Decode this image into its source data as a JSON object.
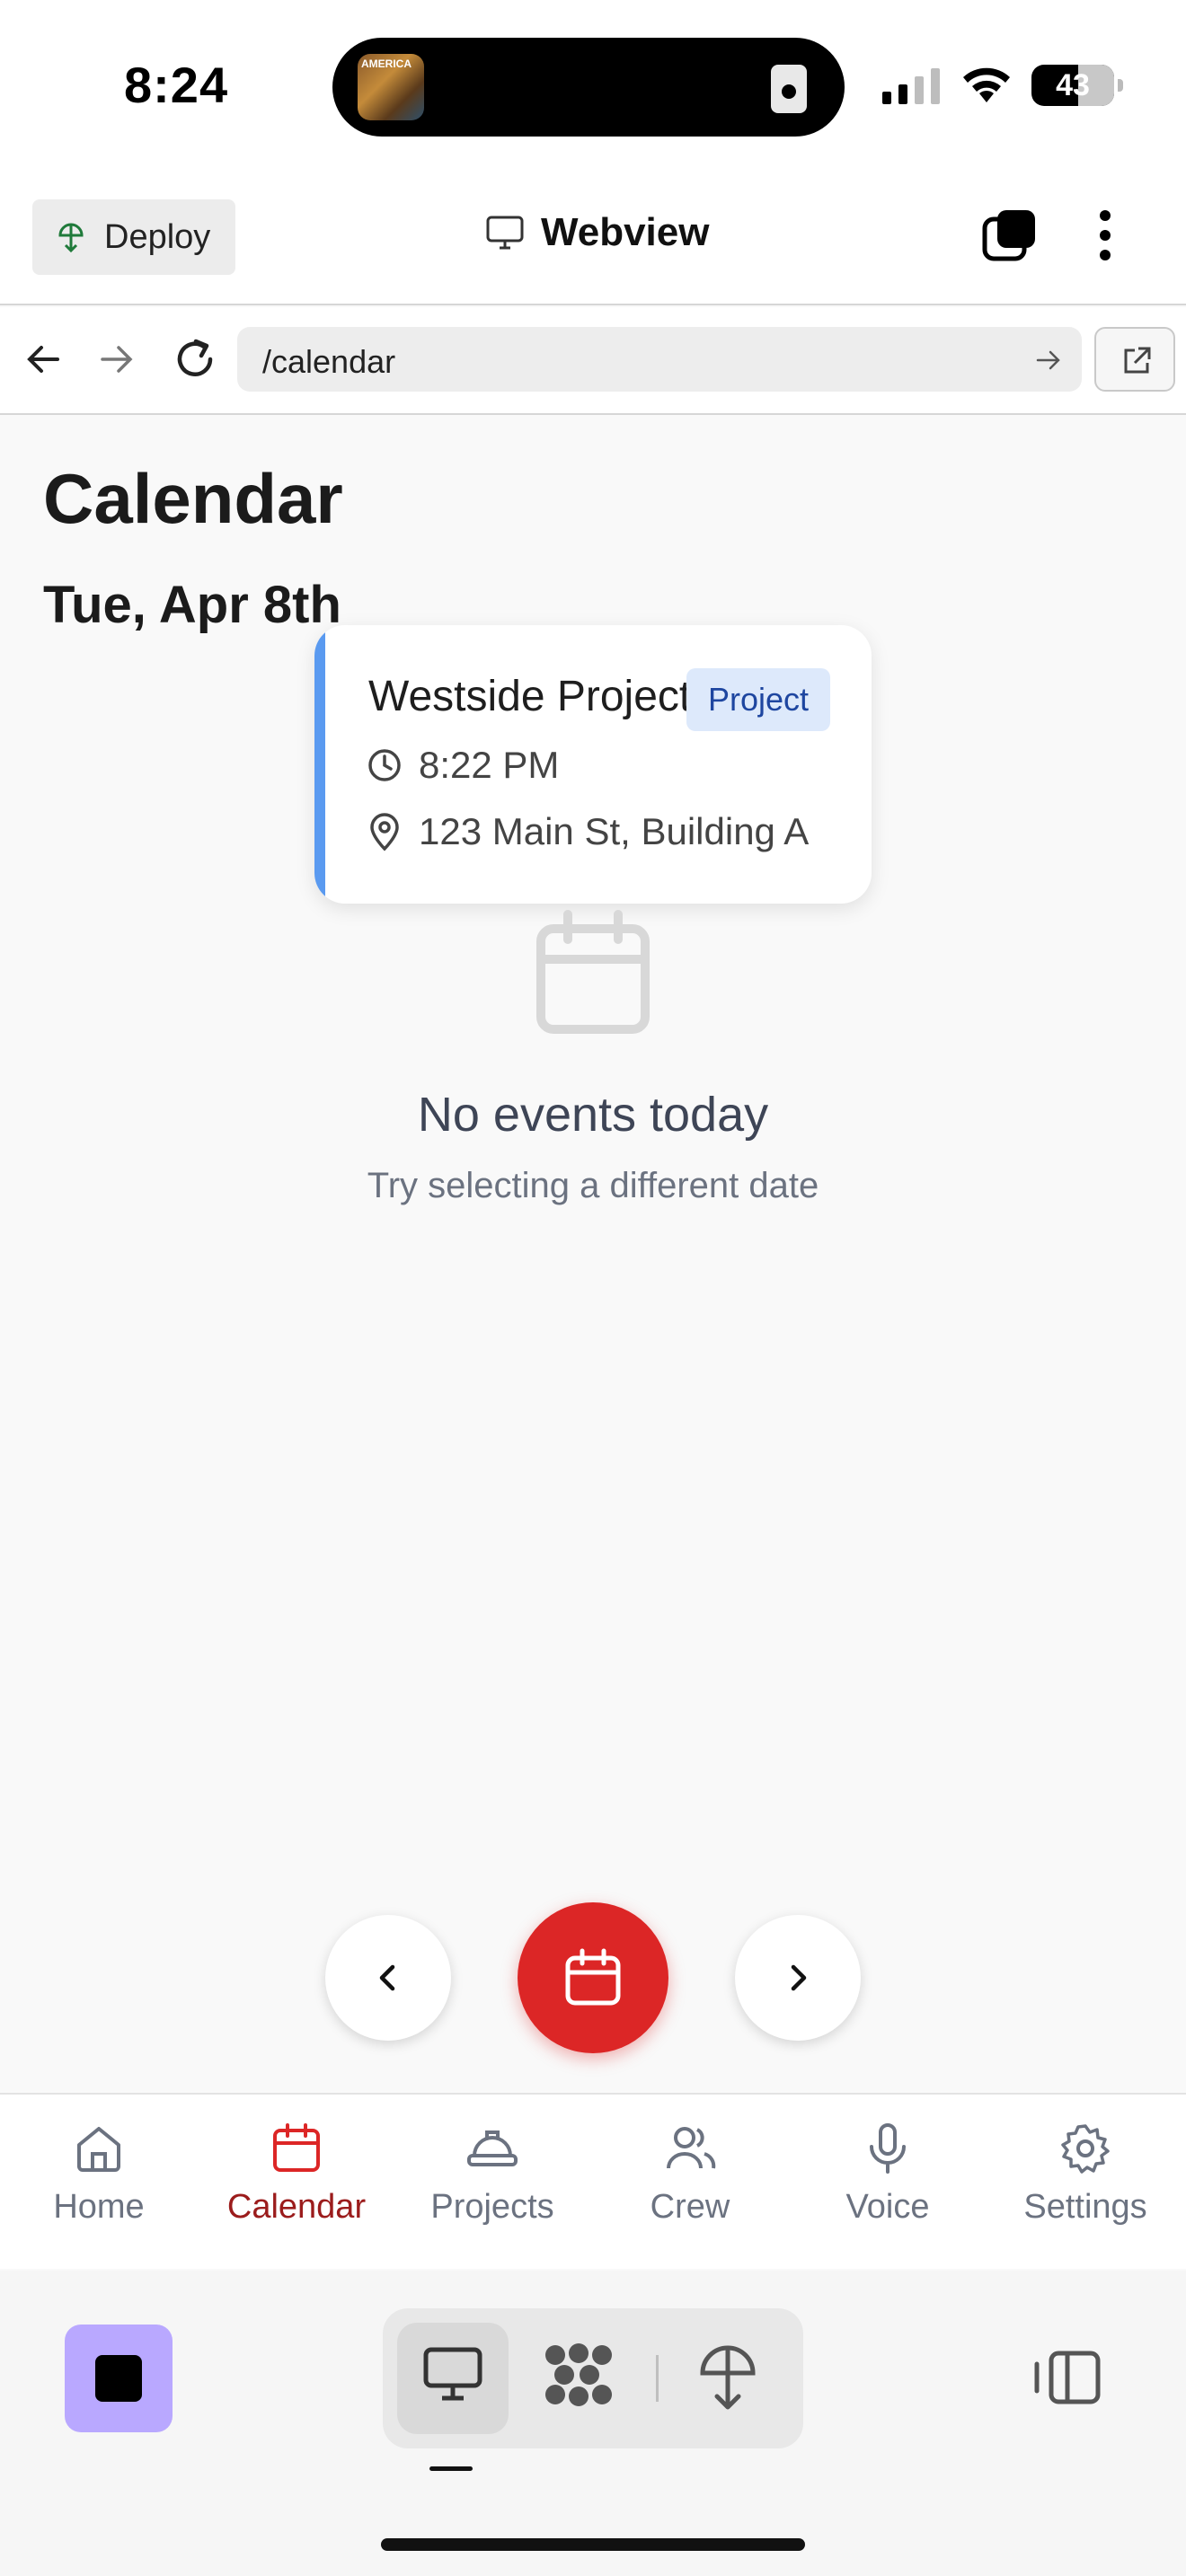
{
  "status_bar": {
    "time": "8:24",
    "battery": "43",
    "album_art_text": "AMERICA"
  },
  "header": {
    "deploy_label": "Deploy",
    "title": "Webview"
  },
  "url_bar": {
    "path": "/calendar"
  },
  "page": {
    "title": "Calendar",
    "date": "Tue, Apr 8th"
  },
  "event": {
    "title": "Westside Project",
    "badge": "Project",
    "time": "8:22 PM",
    "location": "123 Main St, Building A"
  },
  "empty_state": {
    "title": "No events today",
    "subtitle": "Try selecting a different date"
  },
  "tabs": [
    {
      "label": "Home",
      "icon": "home-icon"
    },
    {
      "label": "Calendar",
      "icon": "calendar-icon",
      "active": true
    },
    {
      "label": "Projects",
      "icon": "hard-hat-icon"
    },
    {
      "label": "Crew",
      "icon": "users-icon"
    },
    {
      "label": "Voice",
      "icon": "microphone-icon"
    },
    {
      "label": "Settings",
      "icon": "gear-icon"
    }
  ],
  "colors": {
    "accent": "#dc2626",
    "active_tab": "#9b1c1c",
    "event_accent": "#5a9af0",
    "badge_bg": "#dde9fb",
    "stop_button": "#b9a8ff"
  }
}
